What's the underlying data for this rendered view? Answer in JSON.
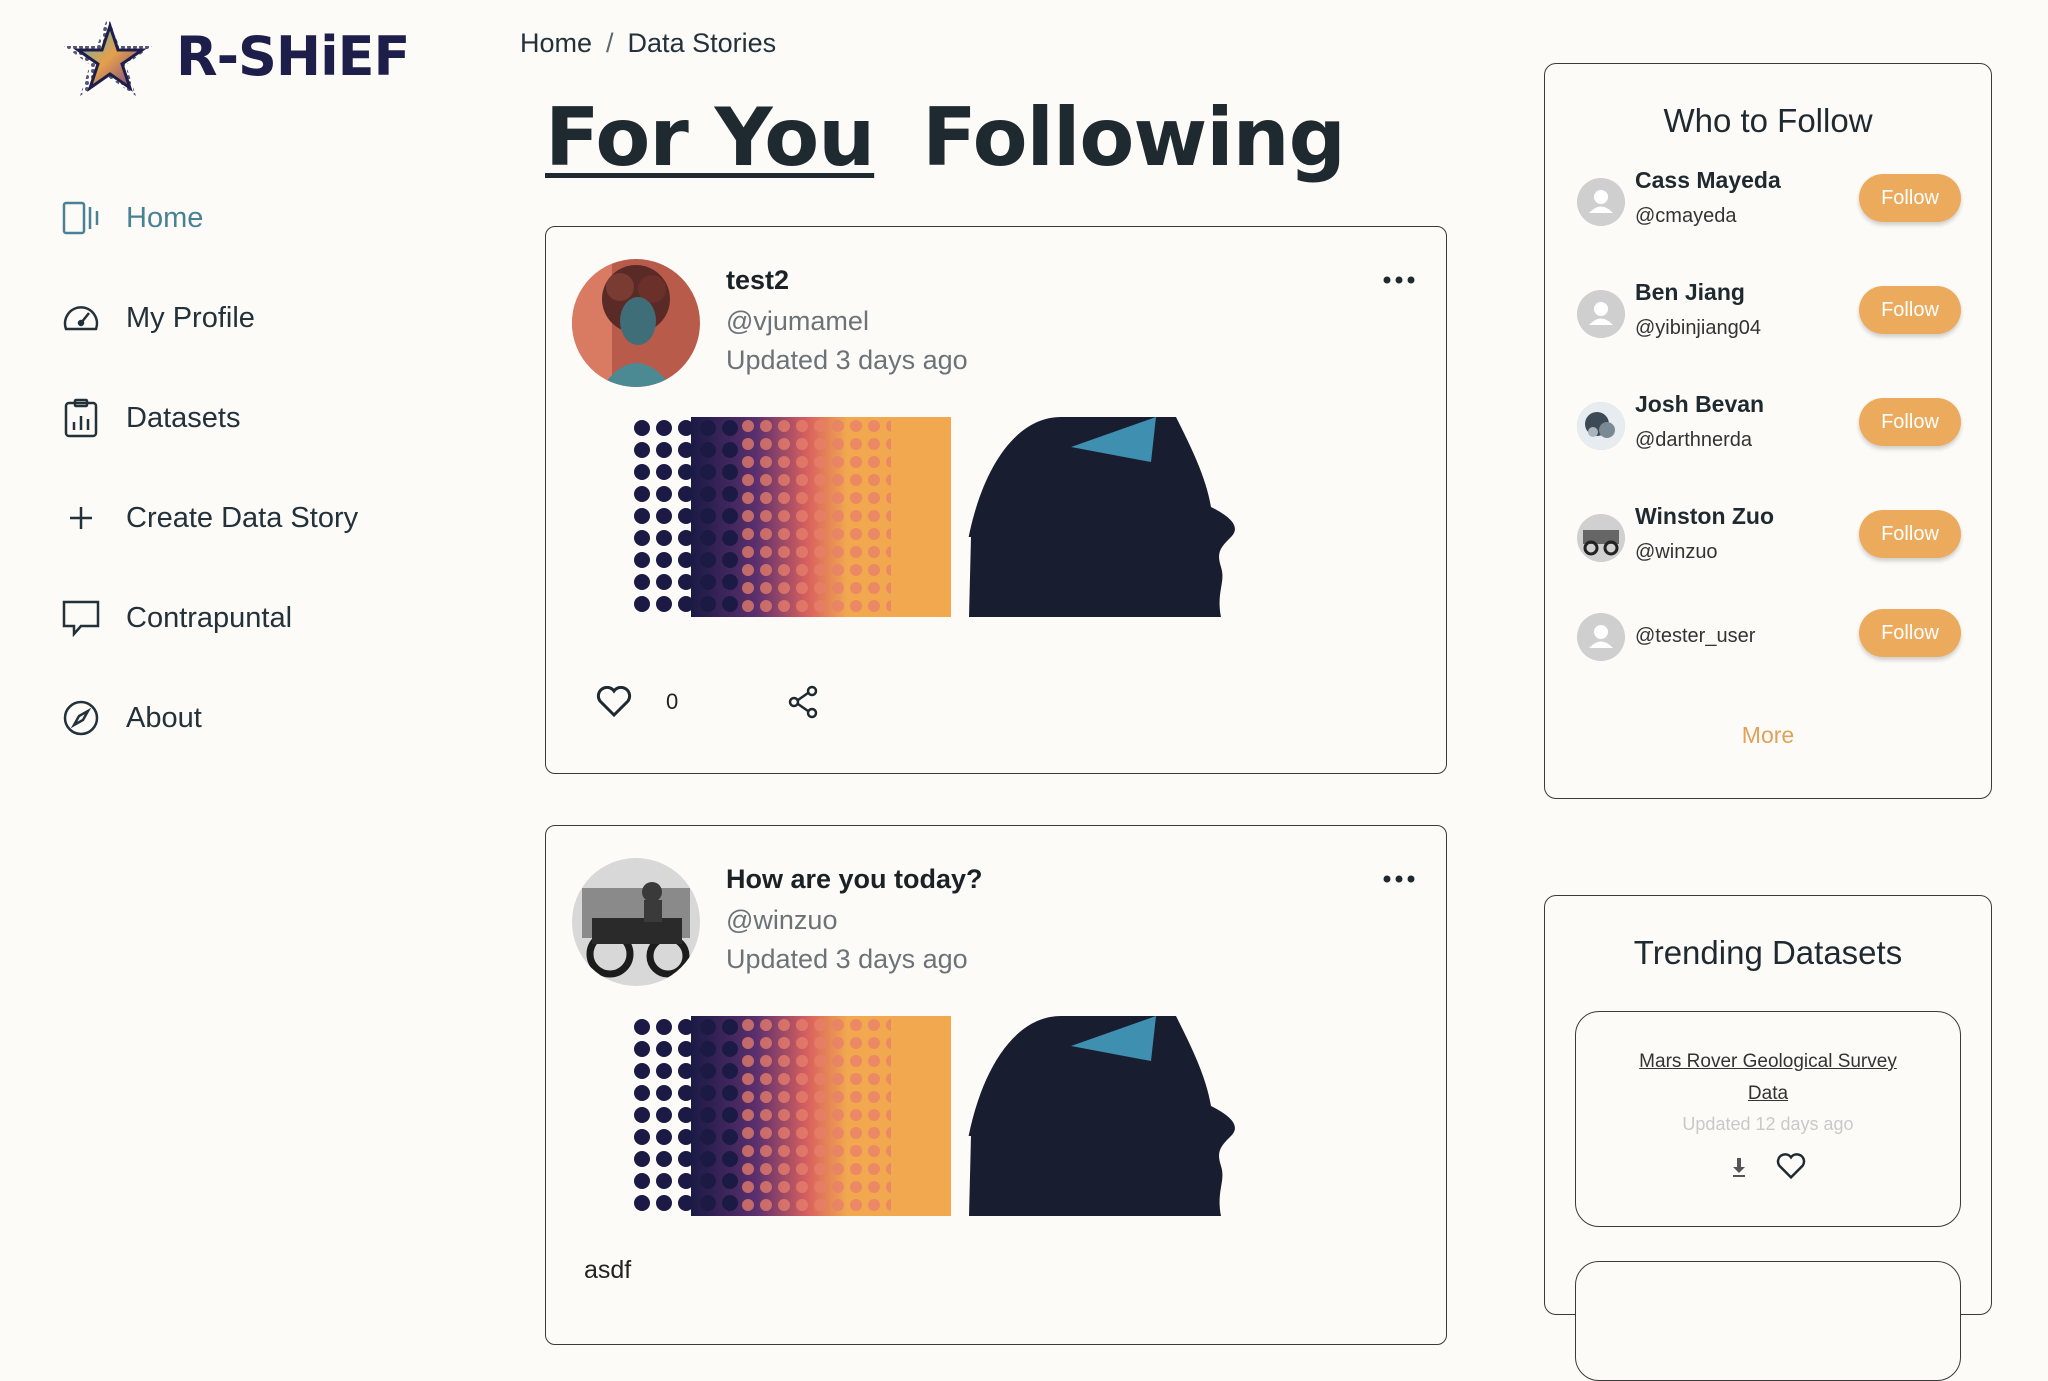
{
  "brand": {
    "name": "R-SHiEF"
  },
  "breadcrumb": {
    "home": "Home",
    "separator": "/",
    "current": "Data Stories"
  },
  "sidebar": {
    "items": [
      {
        "label": "Home",
        "icon": "home-icon",
        "active": true
      },
      {
        "label": "My Profile",
        "icon": "gauge-icon"
      },
      {
        "label": "Datasets",
        "icon": "clipboard-chart-icon"
      },
      {
        "label": "Create Data Story",
        "icon": "plus-icon"
      },
      {
        "label": "Contrapuntal",
        "icon": "speech-bubble-icon"
      },
      {
        "label": "About",
        "icon": "compass-icon"
      }
    ]
  },
  "tabs": [
    {
      "label": "For You",
      "active": true
    },
    {
      "label": "Following",
      "active": false
    }
  ],
  "posts": [
    {
      "title": "test2",
      "handle": "@vjumamel",
      "updated": "Updated 3 days ago",
      "likes": "0"
    },
    {
      "title": "How are you today?",
      "handle": "@winzuo",
      "updated": "Updated 3 days ago",
      "body": "asdf"
    }
  ],
  "who_to_follow": {
    "title": "Who to Follow",
    "follow_label": "Follow",
    "more_label": "More",
    "users": [
      {
        "name": "Cass Mayeda",
        "handle": "@cmayeda"
      },
      {
        "name": "Ben Jiang",
        "handle": "@yibinjiang04"
      },
      {
        "name": "Josh Bevan",
        "handle": "@darthnerda"
      },
      {
        "name": "Winston Zuo",
        "handle": "@winzuo"
      },
      {
        "name": "",
        "handle": "@tester_user"
      }
    ]
  },
  "trending": {
    "title": "Trending Datasets",
    "datasets": [
      {
        "name": "Mars Rover Geological Survey Data",
        "updated": "Updated 12 days ago"
      }
    ]
  },
  "colors": {
    "accent": "#ecaa5c",
    "active_nav": "#4a8195",
    "more_link": "#e0a15a"
  }
}
